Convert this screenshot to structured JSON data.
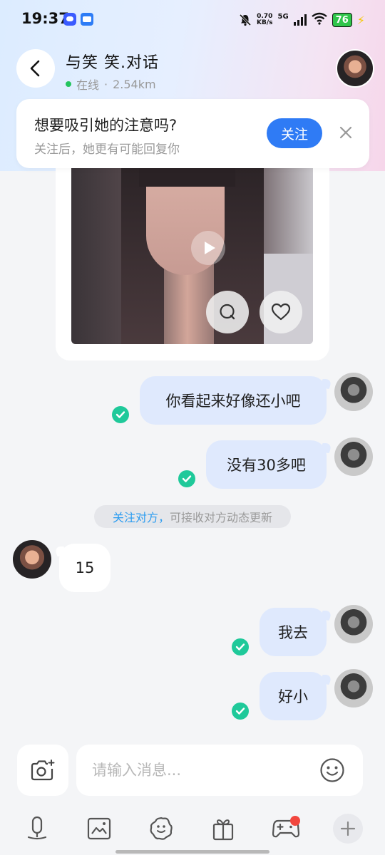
{
  "status_bar": {
    "time": "19:37",
    "net_speed_value": "0.70",
    "net_speed_unit": "KB/s",
    "network_type": "5G",
    "battery": "76"
  },
  "header": {
    "title": "与笑  笑.对话",
    "online_label": "在线",
    "distance": "2.54km"
  },
  "follow_banner": {
    "title": "想要吸引她的注意吗?",
    "subtitle": "关注后，她更有可能回复你",
    "follow_label": "关注"
  },
  "messages": [
    {
      "direction": "sent",
      "text": "你看起来好像还小吧",
      "read": true
    },
    {
      "direction": "sent",
      "text": "没有30多吧",
      "read": true
    },
    {
      "direction": "recv",
      "text": "15"
    },
    {
      "direction": "sent",
      "text": "我去",
      "read": true
    },
    {
      "direction": "sent",
      "text": "好小",
      "read": true
    }
  ],
  "system_notice": {
    "link": "关注对方，",
    "text": "可接收对方动态更新"
  },
  "input": {
    "placeholder": "请输入消息..."
  },
  "toolbar": {
    "items": [
      "voice-icon",
      "image-icon",
      "sticker-icon",
      "gift-icon",
      "game-icon",
      "more-icon"
    ]
  },
  "colors": {
    "accent": "#2f7bf5",
    "read_check": "#1fc99a",
    "sent_bubble": "#dfe9fd",
    "online": "#23c45e",
    "notice_link": "#2b9cf0"
  }
}
